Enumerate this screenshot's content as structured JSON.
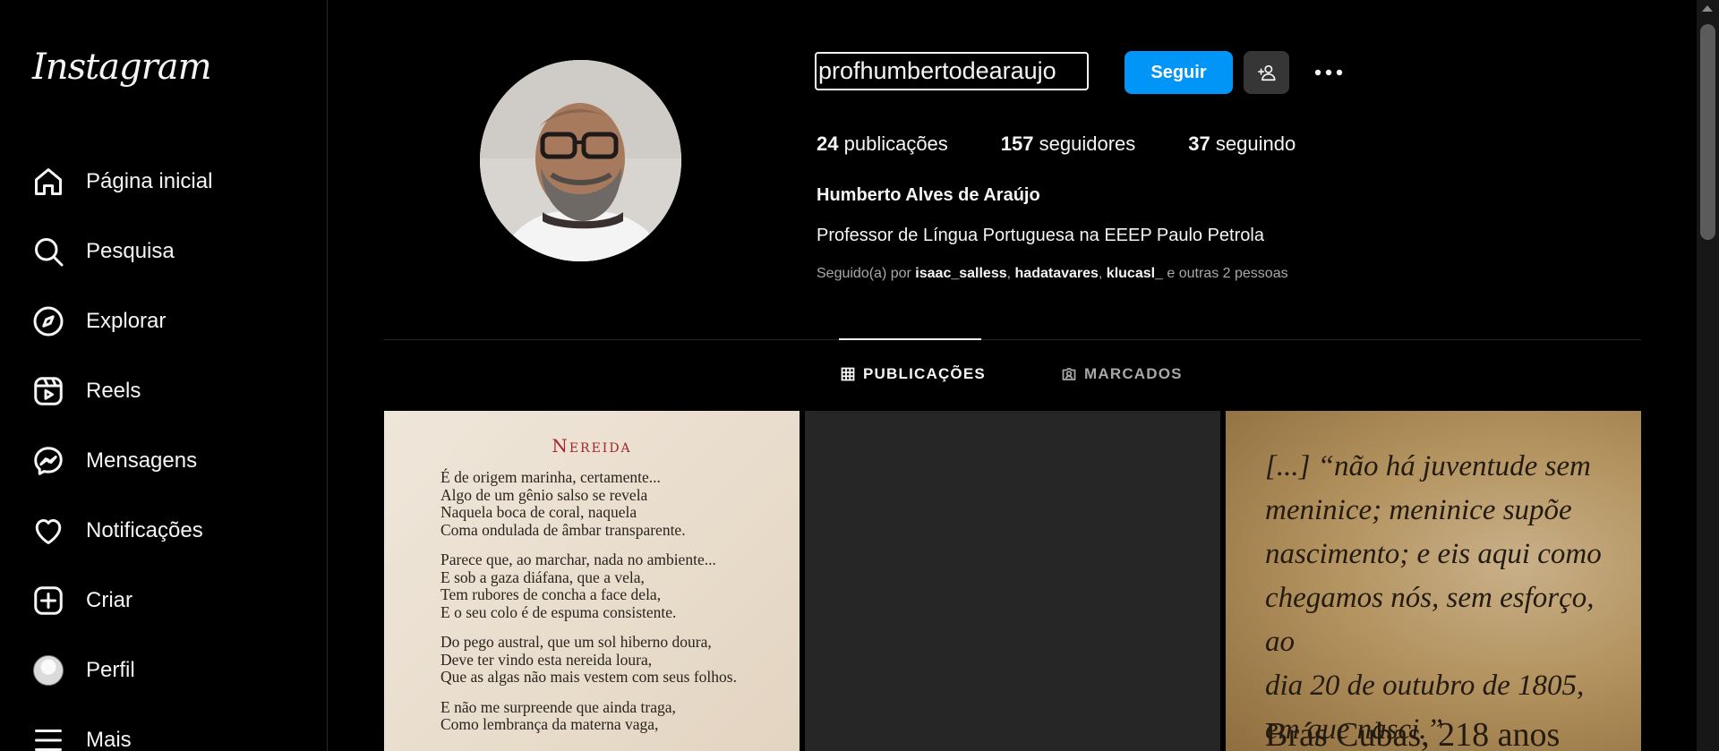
{
  "app": {
    "logo": "Instagram"
  },
  "sidebar": {
    "items": [
      {
        "label": "Página inicial",
        "icon": "home-icon"
      },
      {
        "label": "Pesquisa",
        "icon": "search-icon"
      },
      {
        "label": "Explorar",
        "icon": "compass-icon"
      },
      {
        "label": "Reels",
        "icon": "reels-icon"
      },
      {
        "label": "Mensagens",
        "icon": "messenger-icon"
      },
      {
        "label": "Notificações",
        "icon": "heart-icon"
      },
      {
        "label": "Criar",
        "icon": "plus-square-icon"
      },
      {
        "label": "Perfil",
        "icon": "avatar"
      },
      {
        "label": "Mais",
        "icon": "menu-icon"
      }
    ]
  },
  "profile": {
    "username": "profhumbertodearaujo",
    "follow_label": "Seguir",
    "stats": {
      "posts_count": "24",
      "posts_label": "publicações",
      "followers_count": "157",
      "followers_label": "seguidores",
      "following_count": "37",
      "following_label": "seguindo"
    },
    "full_name": "Humberto Alves de Araújo",
    "bio": "Professor de Língua Portuguesa na EEEP Paulo Petrola",
    "followed_by": {
      "prefix": "Seguido(a) por",
      "users": [
        "isaac_salless",
        "hadatavares",
        "klucasl_"
      ],
      "suffix": "e outras 2 pessoas"
    }
  },
  "tabs": {
    "posts": "PUBLICAÇÕES",
    "tagged": "MARCADOS"
  },
  "posts": {
    "post1": {
      "title": "Nereida",
      "stanzas": [
        [
          "É de origem marinha, certamente...",
          "Algo de um gênio salso se revela",
          "Naquela boca de coral, naquela",
          "Coma ondulada de âmbar transparente."
        ],
        [
          "Parece que, ao marchar, nada no ambiente...",
          "E sob a gaza diáfana, que a vela,",
          "Tem rubores de concha a face dela,",
          "E o seu colo é de espuma consistente."
        ],
        [
          "Do pego austral, que um sol hiberno doura,",
          "Deve ter vindo esta nereida loura,",
          "Que as algas não mais vestem com seus folhos."
        ],
        [
          "E não me surpreende que ainda traga,",
          "Como lembrança da materna vaga,"
        ]
      ]
    },
    "post3": {
      "quote_lines": [
        "[...] “não há juventude sem",
        "meninice; meninice supõe",
        "nascimento; e eis aqui como",
        "chegamos nós, sem esforço, ao",
        "dia 20 de outubro de 1805,",
        "em que nasci.”"
      ],
      "signature": "Brás Cubas, 218 anos"
    }
  }
}
